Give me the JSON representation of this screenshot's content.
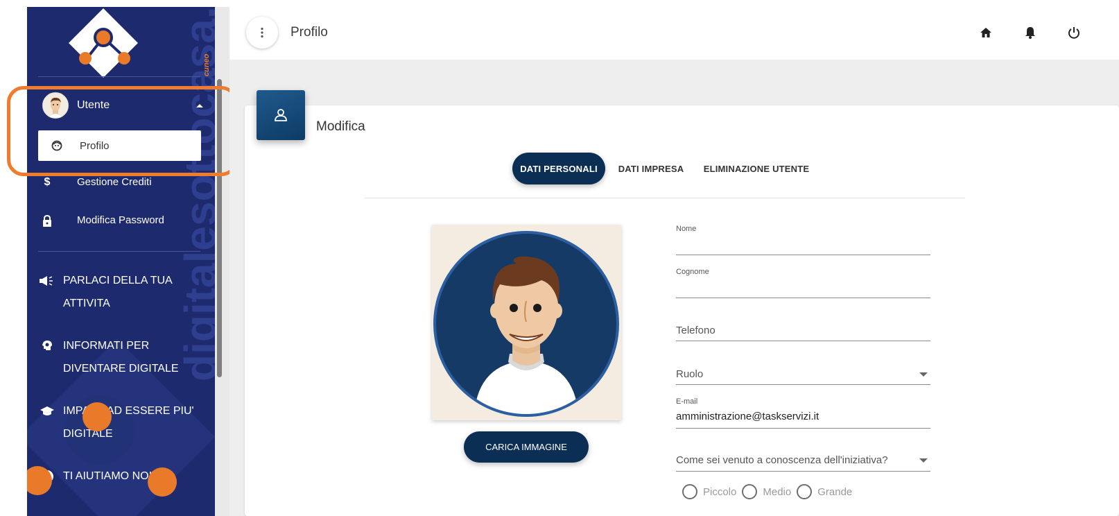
{
  "sidebar": {
    "watermark": "digitalesottocasa.it",
    "watermark_sub": "cuneo",
    "user_label": "Utente",
    "submenu": {
      "profilo": "Profilo",
      "crediti": "Gestione Crediti",
      "password": "Modifica Password"
    },
    "nav": [
      {
        "line1": "PARLACI DELLA TUA",
        "line2": "ATTIVITA",
        "icon": "megaphone-icon"
      },
      {
        "line1": "INFORMATI PER",
        "line2": "DIVENTARE DIGITALE",
        "icon": "head-gear-icon"
      },
      {
        "line1": "IMPARA AD ESSERE PIU'",
        "line2": "DIGITALE",
        "icon": "graduation-cap-icon"
      },
      {
        "line1": "TI AIUTIAMO NOI",
        "line2": "",
        "icon": "info-icon"
      }
    ]
  },
  "header": {
    "title": "Profilo",
    "icons": [
      "home-icon",
      "bell-icon",
      "power-icon"
    ]
  },
  "card": {
    "title": "Modifica",
    "tabs": [
      "DATI PERSONALI",
      "DATI IMPRESA",
      "ELIMINAZIONE UTENTE"
    ],
    "active_tab": "DATI PERSONALI",
    "upload_label": "CARICA IMMAGINE",
    "fields": {
      "nome_label": "Nome",
      "nome_value": "",
      "cognome_label": "Cognome",
      "cognome_value": "",
      "telefono_label": "Telefono",
      "ruolo_label": "Ruolo",
      "email_label": "E-mail",
      "email_value": "amministrazione@taskservizi.it",
      "conoscenza_label": "Come sei venuto a conoscenza dell'iniziativa?"
    },
    "size_options": [
      "Piccolo",
      "Medio",
      "Grande"
    ]
  },
  "colors": {
    "sidebar_bg": "#1e2a6e",
    "accent_orange": "#e87a2a",
    "primary_navy": "#0b2e55",
    "highlight": "#ef7b2e"
  }
}
